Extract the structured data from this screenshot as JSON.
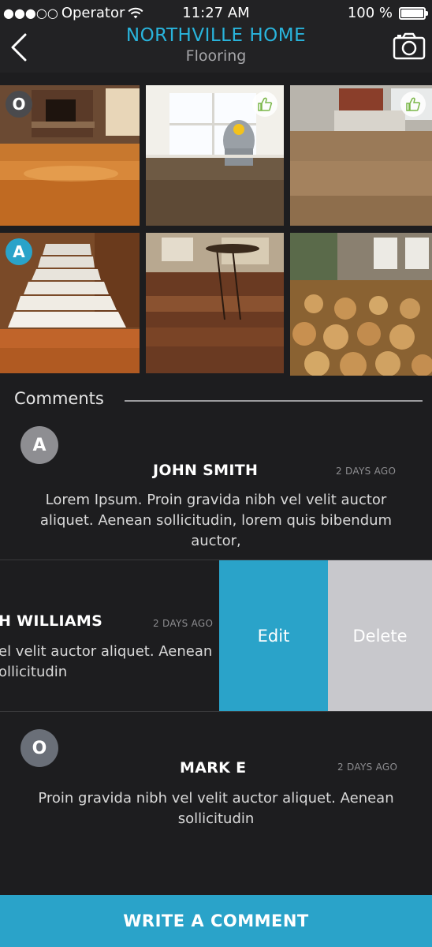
{
  "status_bar": {
    "carrier": "Operator",
    "signal_dots": "●●●○○",
    "time": "11:27 AM",
    "battery": "100 %"
  },
  "nav": {
    "title": "NORTHVILLE HOME",
    "subtitle": "Flooring"
  },
  "gallery": {
    "photos": [
      {
        "badge": "O",
        "liked": false
      },
      {
        "badge": "",
        "liked": true
      },
      {
        "badge": "",
        "liked": true
      },
      {
        "badge": "A",
        "liked": false
      },
      {
        "badge": "",
        "liked": false
      },
      {
        "badge": "",
        "liked": false
      }
    ]
  },
  "comments": {
    "header": "Comments",
    "items": [
      {
        "avatar": "A",
        "name": "JOHN SMITH",
        "time": "2 DAYS AGO",
        "body_lines": [
          "Lorem Ipsum. Proin gravida nibh vel velit auctor",
          "aliquet. Aenean sollicitudin, lorem quis bibendum",
          "auctor,"
        ]
      },
      {
        "name": "H WILLIAMS",
        "time": "2 DAYS AGO",
        "body_lines": [
          "el velit auctor aliquet. Aenean",
          "ollicitudin"
        ]
      },
      {
        "avatar": "O",
        "name": "MARK E",
        "time": "2 DAYS AGO",
        "body_lines": [
          "Proin gravida nibh vel velit auctor aliquet. Aenean",
          "sollicitudin"
        ]
      }
    ]
  },
  "actions": {
    "edit": "Edit",
    "delete": "Delete",
    "write_comment": "WRITE A COMMENT"
  },
  "colors": {
    "accent": "#2aa3c9",
    "title": "#29b4dc",
    "background": "#1d1d1f",
    "delete": "#c8c8cc"
  }
}
